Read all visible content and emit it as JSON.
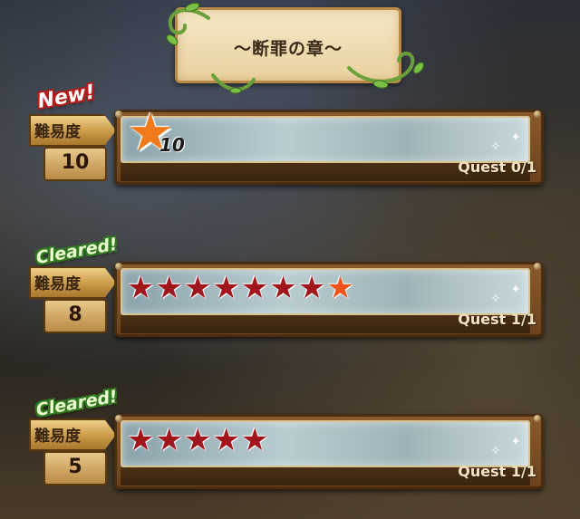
{
  "chapter": {
    "title": "〜断罪の章〜"
  },
  "quests": [
    {
      "badge": "New!",
      "badge_type": "new",
      "difficulty_label": "難易度",
      "level": "10",
      "progress": "Quest 0/1",
      "star_display": "single",
      "star_count": 10,
      "star_count_label": "10"
    },
    {
      "badge": "Cleared!",
      "badge_type": "cleared",
      "difficulty_label": "難易度",
      "level": "8",
      "progress": "Quest 1/1",
      "star_display": "row",
      "star_count": 8
    },
    {
      "badge": "Cleared!",
      "badge_type": "cleared",
      "difficulty_label": "難易度",
      "level": "5",
      "progress": "Quest 1/1",
      "star_display": "row",
      "star_count": 5
    }
  ],
  "colors": {
    "star_dark": "#a0161c",
    "star_bright": "#f0541c",
    "badge_new_outline": "#b81a1a",
    "badge_cleared_outline": "#2f7a1f"
  },
  "icons": {
    "star": "star-icon",
    "sparkle": "sparkle-icon"
  }
}
